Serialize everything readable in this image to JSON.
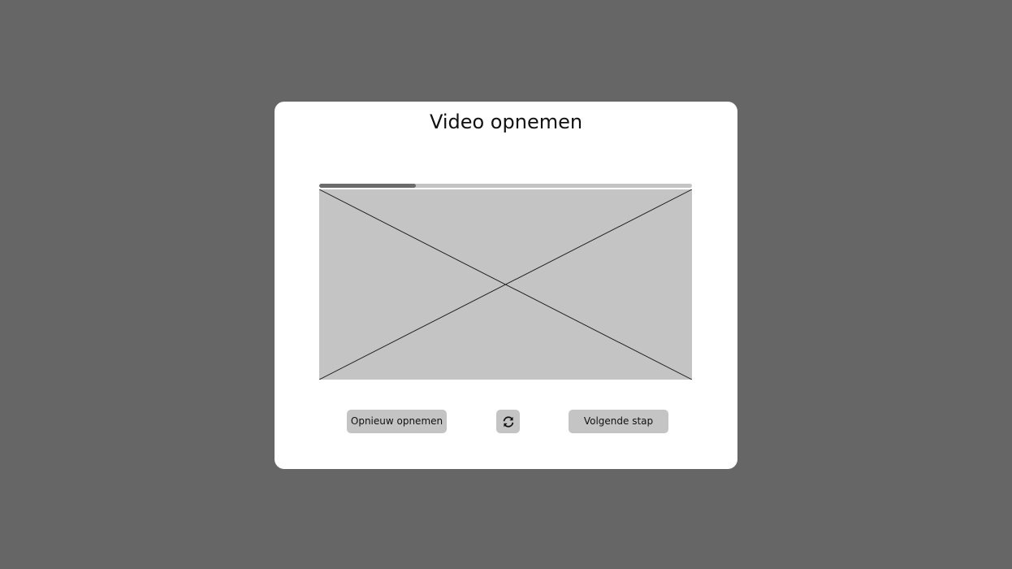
{
  "modal": {
    "title": "Video opnemen"
  },
  "recording": {
    "progress": 0.26
  },
  "video": {
    "placeholder": "image-placeholder-icon"
  },
  "actions": {
    "redo_label": "Opnieuw opnemen",
    "switch_icon": "refresh-icon",
    "next_label": "Volgende stap"
  },
  "colors": {
    "backdrop": "#666666",
    "modal": "#ffffff",
    "placeholder": "#c4c4c4",
    "progress_fill": "#6b6b6b"
  }
}
